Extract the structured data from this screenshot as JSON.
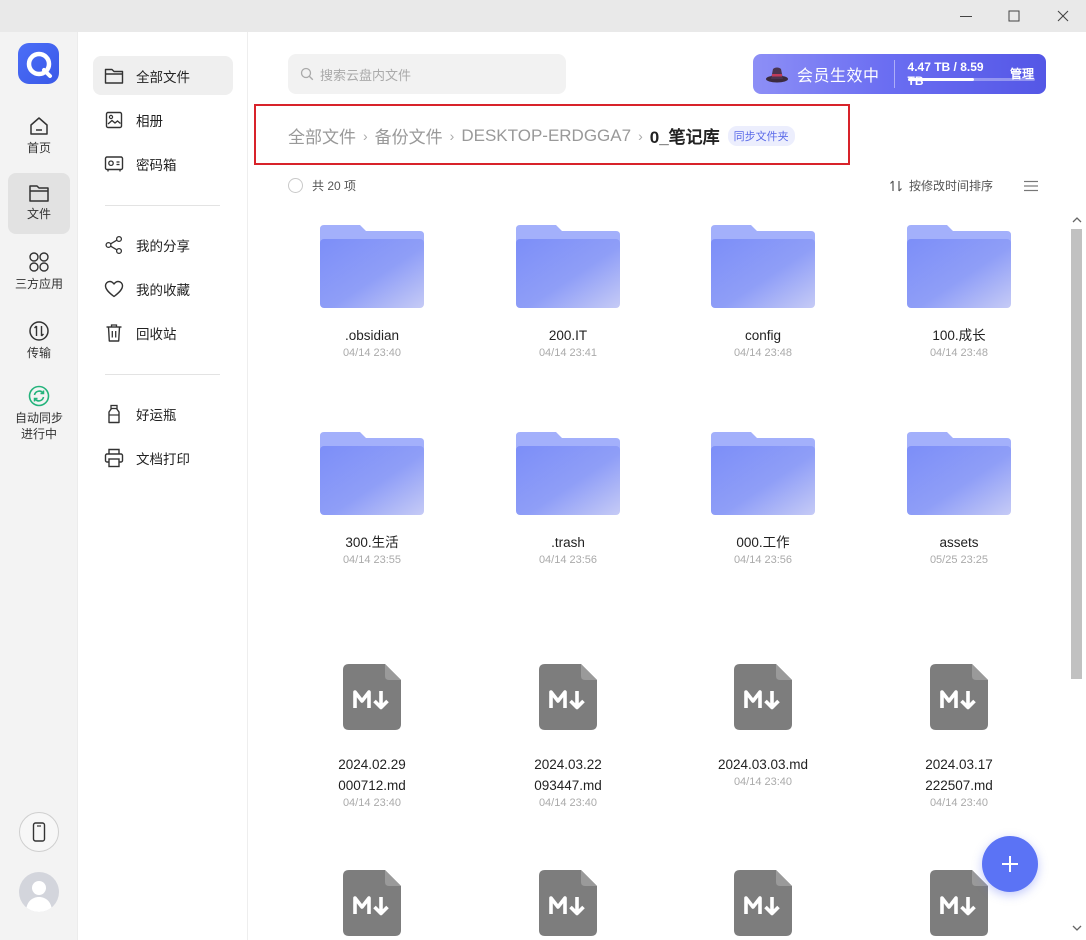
{
  "window": {
    "minimize_label": "",
    "maximize_label": "",
    "close_label": ""
  },
  "rail": {
    "items": [
      {
        "label": "首页",
        "icon": "home-icon"
      },
      {
        "label": "文件",
        "icon": "folder-icon"
      },
      {
        "label": "三方应用",
        "icon": "apps-icon"
      },
      {
        "label": "传输",
        "icon": "transfer-icon"
      }
    ],
    "sync": {
      "line1": "自动同步",
      "line2": "进行中",
      "color": "#23b37b"
    }
  },
  "sidebar": {
    "items": [
      {
        "label": "全部文件",
        "icon": "folder-icon"
      },
      {
        "label": "相册",
        "icon": "photo-icon"
      },
      {
        "label": "密码箱",
        "icon": "safe-icon"
      },
      {
        "label": "我的分享",
        "icon": "share-icon"
      },
      {
        "label": "我的收藏",
        "icon": "heart-icon"
      },
      {
        "label": "回收站",
        "icon": "trash-icon"
      },
      {
        "label": "好运瓶",
        "icon": "bottle-icon"
      },
      {
        "label": "文档打印",
        "icon": "printer-icon"
      }
    ]
  },
  "search": {
    "placeholder": "搜索云盘内文件"
  },
  "vip": {
    "status": "会员生效中",
    "capacity": "4.47 TB / 8.59 TB",
    "used_fraction": 0.52,
    "manage_label": "管理",
    "accent": "#6b6ef2"
  },
  "breadcrumb": {
    "items": [
      "全部文件",
      "备份文件",
      "DESKTOP-ERDGGA7"
    ],
    "separator": "›",
    "current": "0_笔记库",
    "tag": "同步文件夹"
  },
  "toolbar": {
    "count_label": "共 20 项",
    "sort_label": "按修改时间排序"
  },
  "files": [
    {
      "type": "folder",
      "name": ".obsidian",
      "time": "04/14 23:40"
    },
    {
      "type": "folder",
      "name": "200.IT",
      "time": "04/14 23:41"
    },
    {
      "type": "folder",
      "name": "config",
      "time": "04/14 23:48"
    },
    {
      "type": "folder",
      "name": "100.成长",
      "time": "04/14 23:48"
    },
    {
      "type": "folder",
      "name": "300.生活",
      "time": "04/14 23:55"
    },
    {
      "type": "folder",
      "name": ".trash",
      "time": "04/14 23:56"
    },
    {
      "type": "folder",
      "name": "000.工作",
      "time": "04/14 23:56"
    },
    {
      "type": "folder",
      "name": "assets",
      "time": "05/25 23:25"
    },
    {
      "type": "markdown",
      "name": "2024.02.29 000712.md",
      "time": "04/14 23:40"
    },
    {
      "type": "markdown",
      "name": "2024.03.22 093447.md",
      "time": "04/14 23:40"
    },
    {
      "type": "markdown",
      "name": "2024.03.03.md",
      "time": "04/14 23:40"
    },
    {
      "type": "markdown",
      "name": "2024.03.17 222507.md",
      "time": "04/14 23:40"
    },
    {
      "type": "markdown",
      "name": "",
      "time": ""
    },
    {
      "type": "markdown",
      "name": "",
      "time": ""
    },
    {
      "type": "markdown",
      "name": "",
      "time": ""
    },
    {
      "type": "markdown",
      "name": "",
      "time": ""
    }
  ],
  "fab": {
    "icon": "plus-icon",
    "color": "#5b73f5"
  }
}
